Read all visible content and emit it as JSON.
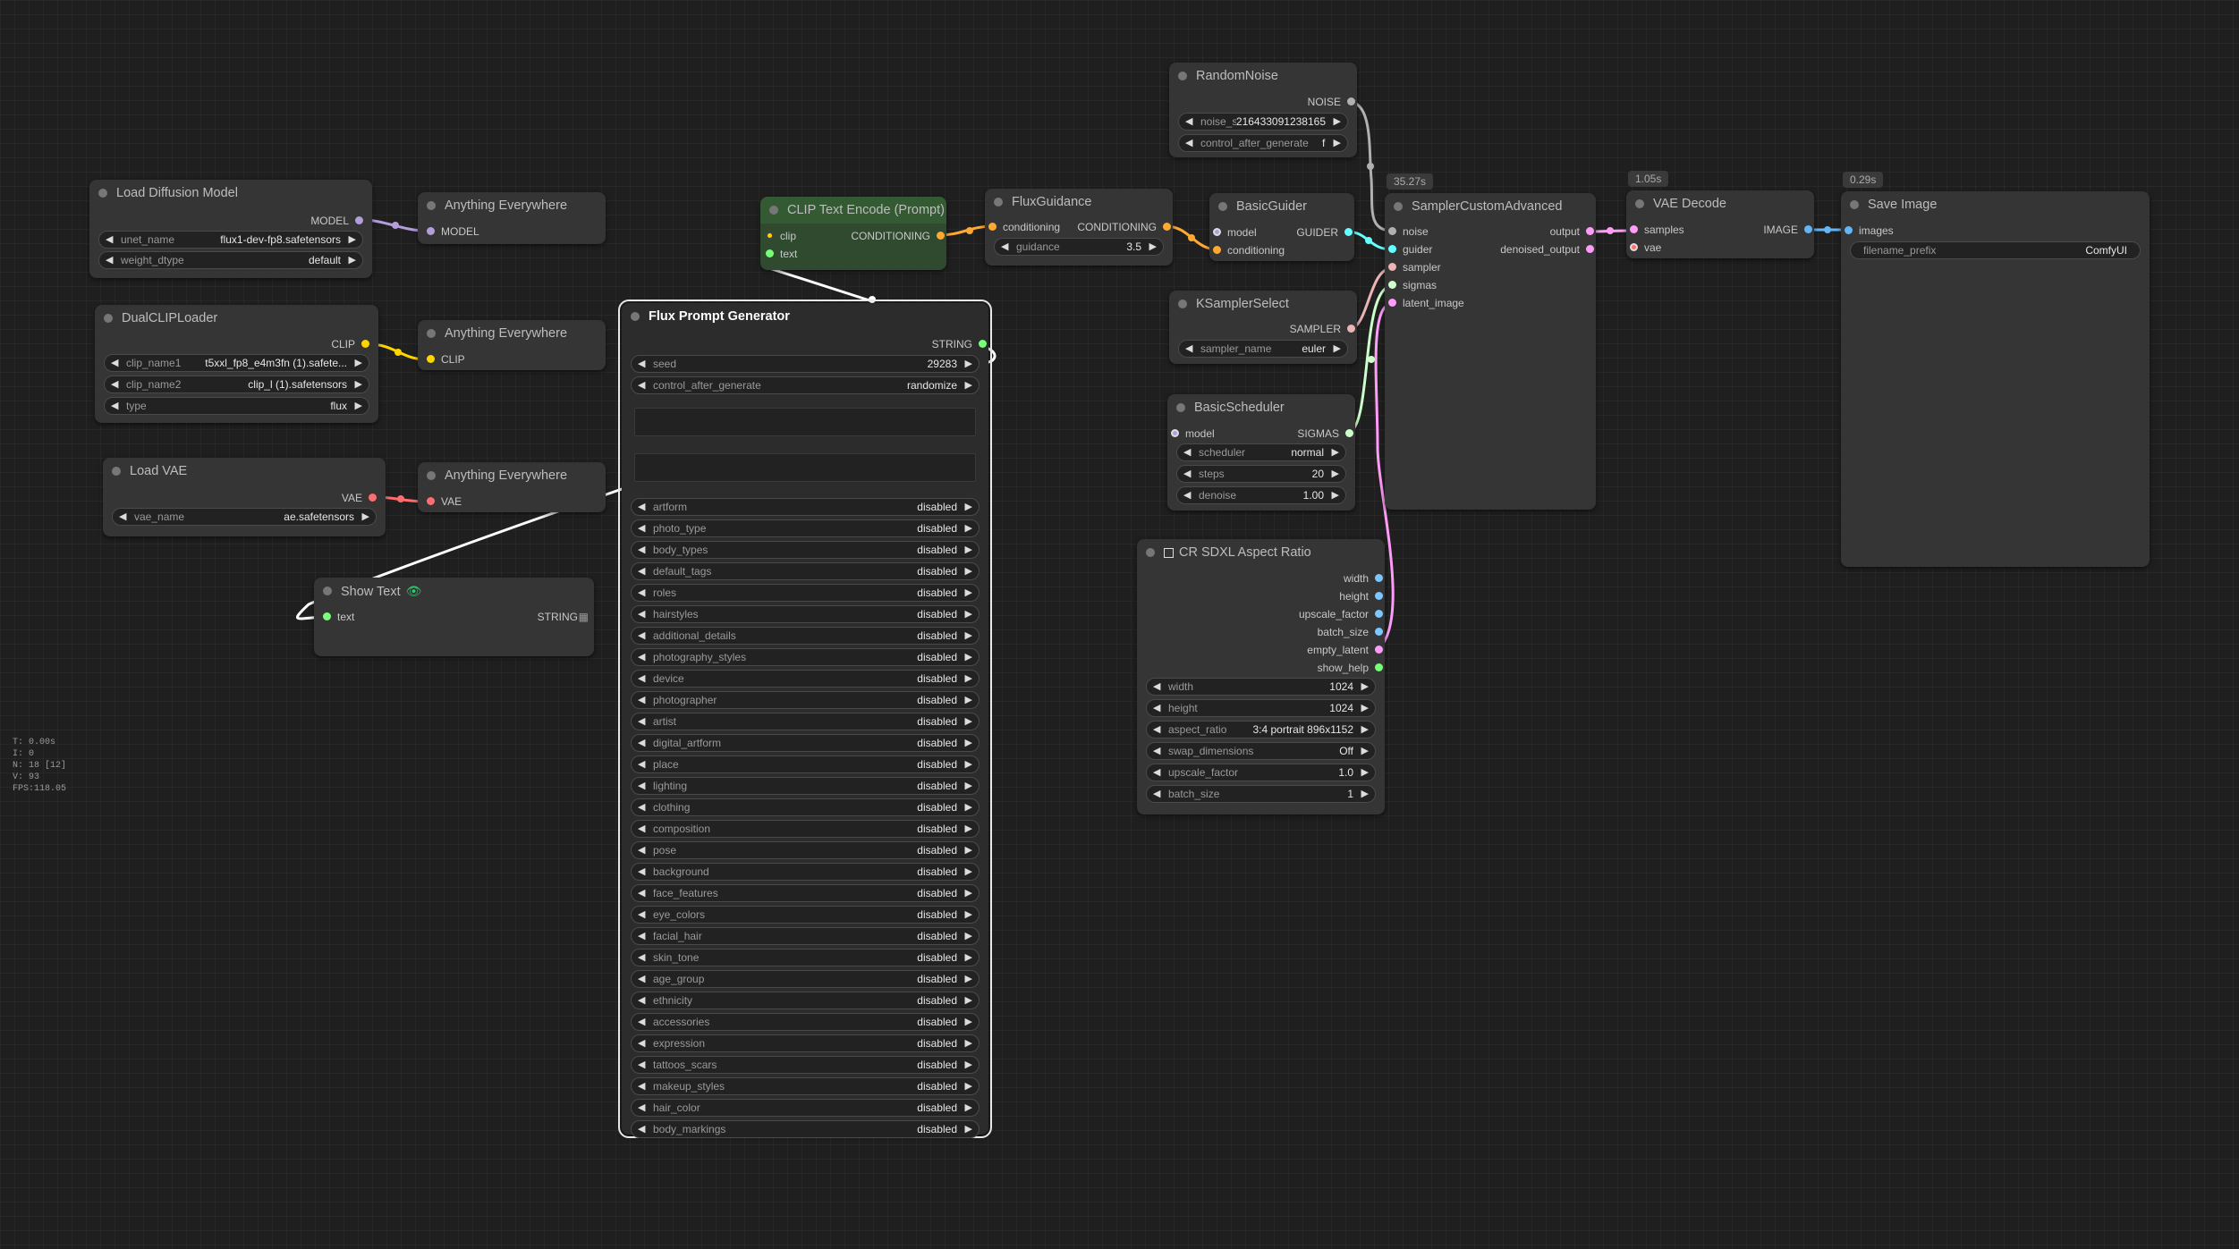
{
  "stats": {
    "t": "T: 0.00s",
    "i": "I: 0",
    "n": "N: 18 [12]",
    "v": "V: 93",
    "fps": "FPS:118.05"
  },
  "colors": {
    "model": "#b39ddb",
    "clip": "#ffd500",
    "vae": "#ff6e6e",
    "conditioning": "#ffa931",
    "latent": "#ff9cf9",
    "image": "#64b5f6",
    "noise": "#b0b0b0",
    "guider": "#66ffff",
    "sampler": "#ecb4b4",
    "sigmas": "#cdffcd",
    "string": "#77ff77",
    "int": "#7cc7ff"
  },
  "load_diffusion": {
    "title": "Load Diffusion Model",
    "out": "MODEL",
    "w1_label": "unet_name",
    "w1_value": "flux1-dev-fp8.safetensors",
    "w2_label": "weight_dtype",
    "w2_value": "default"
  },
  "ae1": {
    "title": "Anything Everywhere",
    "in": "MODEL"
  },
  "ae2": {
    "title": "Anything Everywhere",
    "in": "CLIP"
  },
  "ae3": {
    "title": "Anything Everywhere",
    "in": "VAE"
  },
  "dualclip": {
    "title": "DualCLIPLoader",
    "out": "CLIP",
    "w1_label": "clip_name1",
    "w1_value": "t5xxl_fp8_e4m3fn (1).safete...",
    "w2_label": "clip_name2",
    "w2_value": "clip_l (1).safetensors",
    "w3_label": "type",
    "w3_value": "flux"
  },
  "loadvae": {
    "title": "Load VAE",
    "out": "VAE",
    "w1_label": "vae_name",
    "w1_value": "ae.safetensors"
  },
  "showtext": {
    "title": "Show Text",
    "in": "text",
    "out": "STRING"
  },
  "clipencode": {
    "title": "CLIP Text Encode (Prompt)",
    "in1": "clip",
    "in2": "text",
    "out": "CONDITIONING"
  },
  "fluxguidance": {
    "title": "FluxGuidance",
    "in": "conditioning",
    "out": "CONDITIONING",
    "w1_label": "guidance",
    "w1_value": "3.5"
  },
  "basicguider": {
    "title": "BasicGuider",
    "in1": "model",
    "in2": "conditioning",
    "out": "GUIDER"
  },
  "randomnoise": {
    "title": "RandomNoise",
    "out": "NOISE",
    "w1_label": "noise_seed",
    "w1_value": "216433091238165",
    "w2_label": "control_after_generate",
    "w2_value": "fixed"
  },
  "ksamplerselect": {
    "title": "KSamplerSelect",
    "out": "SAMPLER",
    "w1_label": "sampler_name",
    "w1_value": "euler"
  },
  "basicscheduler": {
    "title": "BasicScheduler",
    "in": "model",
    "out": "SIGMAS",
    "w1_label": "scheduler",
    "w1_value": "normal",
    "w2_label": "steps",
    "w2_value": "20",
    "w3_label": "denoise",
    "w3_value": "1.00"
  },
  "sampler": {
    "badge": "35.27s",
    "title": "SamplerCustomAdvanced",
    "in1": "noise",
    "in2": "guider",
    "in3": "sampler",
    "in4": "sigmas",
    "in5": "latent_image",
    "out1": "output",
    "out2": "denoised_output"
  },
  "vaedecode": {
    "badge": "1.05s",
    "title": "VAE Decode",
    "in1": "samples",
    "in2": "vae",
    "out": "IMAGE"
  },
  "saveimage": {
    "badge": "0.29s",
    "title": "Save Image",
    "in": "images",
    "w1_label": "filename_prefix",
    "w1_value": "ComfyUI"
  },
  "crsdxl": {
    "title": "CR SDXL Aspect Ratio",
    "outs": [
      "width",
      "height",
      "upscale_factor",
      "batch_size",
      "empty_latent",
      "show_help"
    ],
    "widgets": [
      {
        "label": "width",
        "value": "1024"
      },
      {
        "label": "height",
        "value": "1024"
      },
      {
        "label": "aspect_ratio",
        "value": "3:4 portrait 896x1152"
      },
      {
        "label": "swap_dimensions",
        "value": "Off"
      },
      {
        "label": "upscale_factor",
        "value": "1.0"
      },
      {
        "label": "batch_size",
        "value": "1"
      }
    ]
  },
  "fluxprompt": {
    "title": "Flux Prompt Generator",
    "out": "STRING",
    "seed_label": "seed",
    "seed_value": "29283",
    "cag_label": "control_after_generate",
    "cag_value": "randomize",
    "options": [
      {
        "label": "artform",
        "value": "disabled"
      },
      {
        "label": "photo_type",
        "value": "disabled"
      },
      {
        "label": "body_types",
        "value": "disabled"
      },
      {
        "label": "default_tags",
        "value": "disabled"
      },
      {
        "label": "roles",
        "value": "disabled"
      },
      {
        "label": "hairstyles",
        "value": "disabled"
      },
      {
        "label": "additional_details",
        "value": "disabled"
      },
      {
        "label": "photography_styles",
        "value": "disabled"
      },
      {
        "label": "device",
        "value": "disabled"
      },
      {
        "label": "photographer",
        "value": "disabled"
      },
      {
        "label": "artist",
        "value": "disabled"
      },
      {
        "label": "digital_artform",
        "value": "disabled"
      },
      {
        "label": "place",
        "value": "disabled"
      },
      {
        "label": "lighting",
        "value": "disabled"
      },
      {
        "label": "clothing",
        "value": "disabled"
      },
      {
        "label": "composition",
        "value": "disabled"
      },
      {
        "label": "pose",
        "value": "disabled"
      },
      {
        "label": "background",
        "value": "disabled"
      },
      {
        "label": "face_features",
        "value": "disabled"
      },
      {
        "label": "eye_colors",
        "value": "disabled"
      },
      {
        "label": "facial_hair",
        "value": "disabled"
      },
      {
        "label": "skin_tone",
        "value": "disabled"
      },
      {
        "label": "age_group",
        "value": "disabled"
      },
      {
        "label": "ethnicity",
        "value": "disabled"
      },
      {
        "label": "accessories",
        "value": "disabled"
      },
      {
        "label": "expression",
        "value": "disabled"
      },
      {
        "label": "tattoos_scars",
        "value": "disabled"
      },
      {
        "label": "makeup_styles",
        "value": "disabled"
      },
      {
        "label": "hair_color",
        "value": "disabled"
      },
      {
        "label": "body_markings",
        "value": "disabled"
      }
    ]
  }
}
